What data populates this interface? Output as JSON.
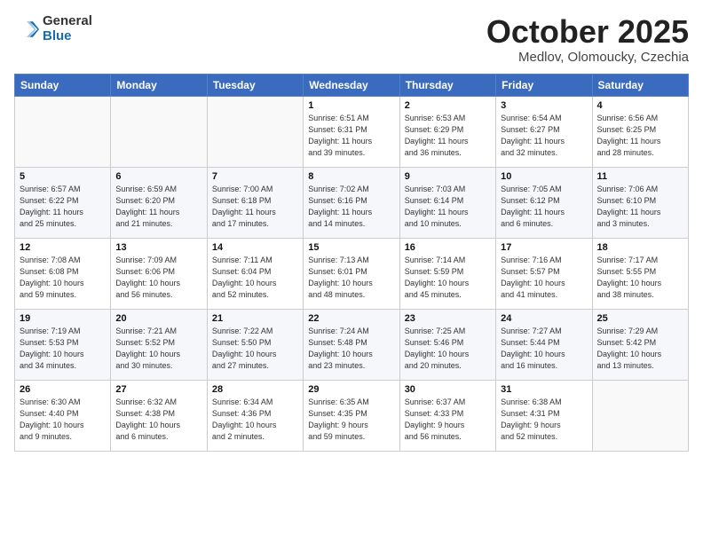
{
  "header": {
    "logo_general": "General",
    "logo_blue": "Blue",
    "month_title": "October 2025",
    "subtitle": "Medlov, Olomoucky, Czechia"
  },
  "weekdays": [
    "Sunday",
    "Monday",
    "Tuesday",
    "Wednesday",
    "Thursday",
    "Friday",
    "Saturday"
  ],
  "weeks": [
    [
      {
        "day": "",
        "info": ""
      },
      {
        "day": "",
        "info": ""
      },
      {
        "day": "",
        "info": ""
      },
      {
        "day": "1",
        "info": "Sunrise: 6:51 AM\nSunset: 6:31 PM\nDaylight: 11 hours\nand 39 minutes."
      },
      {
        "day": "2",
        "info": "Sunrise: 6:53 AM\nSunset: 6:29 PM\nDaylight: 11 hours\nand 36 minutes."
      },
      {
        "day": "3",
        "info": "Sunrise: 6:54 AM\nSunset: 6:27 PM\nDaylight: 11 hours\nand 32 minutes."
      },
      {
        "day": "4",
        "info": "Sunrise: 6:56 AM\nSunset: 6:25 PM\nDaylight: 11 hours\nand 28 minutes."
      }
    ],
    [
      {
        "day": "5",
        "info": "Sunrise: 6:57 AM\nSunset: 6:22 PM\nDaylight: 11 hours\nand 25 minutes."
      },
      {
        "day": "6",
        "info": "Sunrise: 6:59 AM\nSunset: 6:20 PM\nDaylight: 11 hours\nand 21 minutes."
      },
      {
        "day": "7",
        "info": "Sunrise: 7:00 AM\nSunset: 6:18 PM\nDaylight: 11 hours\nand 17 minutes."
      },
      {
        "day": "8",
        "info": "Sunrise: 7:02 AM\nSunset: 6:16 PM\nDaylight: 11 hours\nand 14 minutes."
      },
      {
        "day": "9",
        "info": "Sunrise: 7:03 AM\nSunset: 6:14 PM\nDaylight: 11 hours\nand 10 minutes."
      },
      {
        "day": "10",
        "info": "Sunrise: 7:05 AM\nSunset: 6:12 PM\nDaylight: 11 hours\nand 6 minutes."
      },
      {
        "day": "11",
        "info": "Sunrise: 7:06 AM\nSunset: 6:10 PM\nDaylight: 11 hours\nand 3 minutes."
      }
    ],
    [
      {
        "day": "12",
        "info": "Sunrise: 7:08 AM\nSunset: 6:08 PM\nDaylight: 10 hours\nand 59 minutes."
      },
      {
        "day": "13",
        "info": "Sunrise: 7:09 AM\nSunset: 6:06 PM\nDaylight: 10 hours\nand 56 minutes."
      },
      {
        "day": "14",
        "info": "Sunrise: 7:11 AM\nSunset: 6:04 PM\nDaylight: 10 hours\nand 52 minutes."
      },
      {
        "day": "15",
        "info": "Sunrise: 7:13 AM\nSunset: 6:01 PM\nDaylight: 10 hours\nand 48 minutes."
      },
      {
        "day": "16",
        "info": "Sunrise: 7:14 AM\nSunset: 5:59 PM\nDaylight: 10 hours\nand 45 minutes."
      },
      {
        "day": "17",
        "info": "Sunrise: 7:16 AM\nSunset: 5:57 PM\nDaylight: 10 hours\nand 41 minutes."
      },
      {
        "day": "18",
        "info": "Sunrise: 7:17 AM\nSunset: 5:55 PM\nDaylight: 10 hours\nand 38 minutes."
      }
    ],
    [
      {
        "day": "19",
        "info": "Sunrise: 7:19 AM\nSunset: 5:53 PM\nDaylight: 10 hours\nand 34 minutes."
      },
      {
        "day": "20",
        "info": "Sunrise: 7:21 AM\nSunset: 5:52 PM\nDaylight: 10 hours\nand 30 minutes."
      },
      {
        "day": "21",
        "info": "Sunrise: 7:22 AM\nSunset: 5:50 PM\nDaylight: 10 hours\nand 27 minutes."
      },
      {
        "day": "22",
        "info": "Sunrise: 7:24 AM\nSunset: 5:48 PM\nDaylight: 10 hours\nand 23 minutes."
      },
      {
        "day": "23",
        "info": "Sunrise: 7:25 AM\nSunset: 5:46 PM\nDaylight: 10 hours\nand 20 minutes."
      },
      {
        "day": "24",
        "info": "Sunrise: 7:27 AM\nSunset: 5:44 PM\nDaylight: 10 hours\nand 16 minutes."
      },
      {
        "day": "25",
        "info": "Sunrise: 7:29 AM\nSunset: 5:42 PM\nDaylight: 10 hours\nand 13 minutes."
      }
    ],
    [
      {
        "day": "26",
        "info": "Sunrise: 6:30 AM\nSunset: 4:40 PM\nDaylight: 10 hours\nand 9 minutes."
      },
      {
        "day": "27",
        "info": "Sunrise: 6:32 AM\nSunset: 4:38 PM\nDaylight: 10 hours\nand 6 minutes."
      },
      {
        "day": "28",
        "info": "Sunrise: 6:34 AM\nSunset: 4:36 PM\nDaylight: 10 hours\nand 2 minutes."
      },
      {
        "day": "29",
        "info": "Sunrise: 6:35 AM\nSunset: 4:35 PM\nDaylight: 9 hours\nand 59 minutes."
      },
      {
        "day": "30",
        "info": "Sunrise: 6:37 AM\nSunset: 4:33 PM\nDaylight: 9 hours\nand 56 minutes."
      },
      {
        "day": "31",
        "info": "Sunrise: 6:38 AM\nSunset: 4:31 PM\nDaylight: 9 hours\nand 52 minutes."
      },
      {
        "day": "",
        "info": ""
      }
    ]
  ]
}
